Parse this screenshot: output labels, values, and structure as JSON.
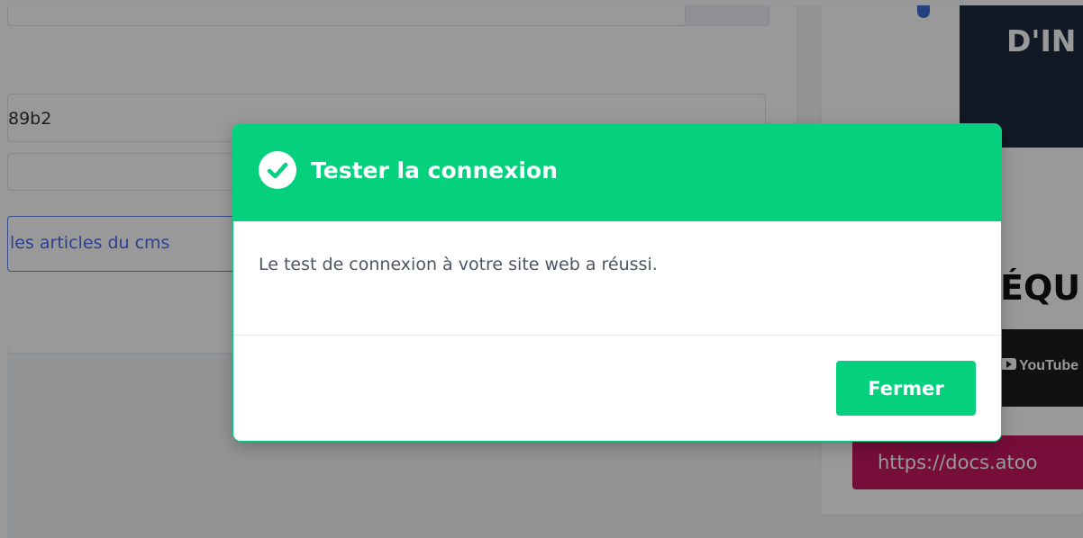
{
  "background": {
    "key_value": "89b2",
    "articles_button_label": "les articles du cms",
    "side_banner_text": "D'IN",
    "side_heading": "ÉQU",
    "video_label": "YouTube",
    "docs_button_label": "https://docs.atoo"
  },
  "modal": {
    "title": "Tester la connexion",
    "icon": "check-circle-icon",
    "message": "Le test de connexion à votre site web a réussi.",
    "close_label": "Fermer",
    "accent_color": "#04d07e"
  }
}
